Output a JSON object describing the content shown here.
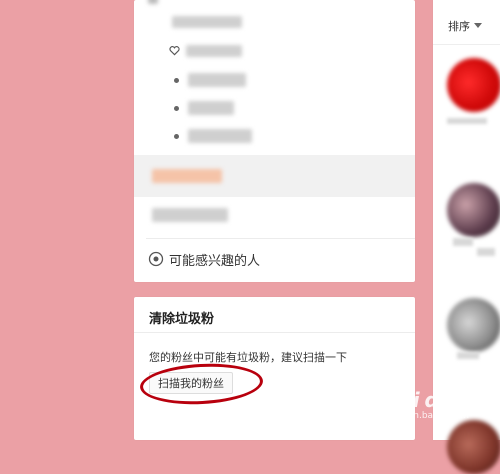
{
  "nav": {
    "recommend_label": "可能感兴趣的人"
  },
  "clean_fans": {
    "title": "清除垃圾粉",
    "description": "您的粉丝中可能有垃圾粉，建议扫描一下",
    "scan_button": "扫描我的粉丝"
  },
  "right_panel": {
    "sort_label": "排序"
  },
  "watermark": {
    "logo_text": "Bai du 经验",
    "subtitle": "jingyan.baidu.com"
  },
  "colors": {
    "page_background": "#eba0a5",
    "annotation_circle": "#b8000d"
  }
}
